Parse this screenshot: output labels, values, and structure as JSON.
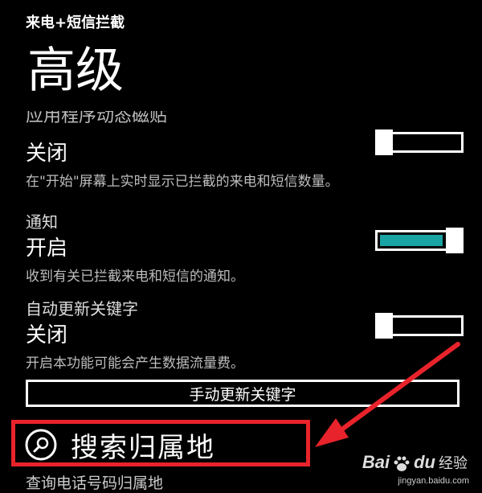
{
  "app": {
    "title": "来电+短信拦截"
  },
  "page": {
    "title": "高级",
    "cut_label": "应用程序动态磁贴"
  },
  "settings": [
    {
      "label": "",
      "state": "关闭",
      "toggle_on": false,
      "description": "在\"开始\"屏幕上实时显示已拦截的来电和短信数量。"
    },
    {
      "label": "通知",
      "state": "开启",
      "toggle_on": true,
      "description": "收到有关已拦截来电和短信的通知。"
    },
    {
      "label": "自动更新关键字",
      "state": "关闭",
      "toggle_on": false,
      "description": "开启本功能可能会产生数据流量费。"
    }
  ],
  "update_button": {
    "label": "手动更新关键字"
  },
  "search": {
    "label": "搜索归属地",
    "description": "查询电话号码归属地",
    "icon": "search-icon"
  },
  "colors": {
    "background": "#000000",
    "accent": "#1aa3a3",
    "highlight": "#e8232b",
    "text": "#ffffff"
  },
  "watermark": {
    "brand": "Bai",
    "brand_suffix": "du",
    "cn": "经验",
    "url": "jingyan.baidu.com"
  }
}
